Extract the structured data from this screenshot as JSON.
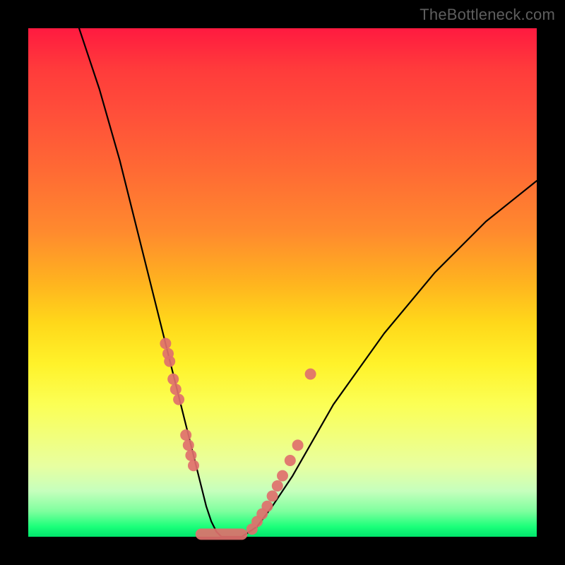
{
  "watermark": "TheBottleneck.com",
  "chart_data": {
    "type": "line",
    "title": "",
    "xlabel": "",
    "ylabel": "",
    "xlim": [
      0,
      100
    ],
    "ylim": [
      0,
      100
    ],
    "curve": {
      "x": [
        10,
        12,
        14,
        16,
        18,
        20,
        22,
        24,
        26,
        27,
        28,
        29,
        30,
        31,
        32,
        33,
        34,
        35,
        36,
        37,
        38,
        40,
        42,
        45,
        48,
        52,
        56,
        60,
        65,
        70,
        75,
        80,
        85,
        90,
        95,
        100
      ],
      "y": [
        100,
        94,
        88,
        81,
        74,
        66,
        58,
        50,
        42,
        38,
        34,
        30,
        26,
        22,
        18,
        14,
        10,
        6,
        3,
        1,
        0,
        0,
        0,
        2,
        6,
        12,
        19,
        26,
        33,
        40,
        46,
        52,
        57,
        62,
        66,
        70
      ]
    },
    "markers_left": {
      "x": [
        27.0,
        27.5,
        27.8,
        28.5,
        29.0,
        29.6,
        31.0,
        31.5,
        32.0,
        32.5
      ],
      "y": [
        38.0,
        36.0,
        34.5,
        31.0,
        29.0,
        27.0,
        20.0,
        18.0,
        16.0,
        14.0
      ]
    },
    "markers_right": {
      "x": [
        44.0,
        45.0,
        46.0,
        47.0,
        48.0,
        49.0,
        50.0,
        51.5,
        53.0
      ],
      "y": [
        1.5,
        3.0,
        4.5,
        6.0,
        8.0,
        10.0,
        12.0,
        15.0,
        18.0
      ]
    },
    "markers_right_outlier": {
      "x": 55.5,
      "y": 32.0
    },
    "valley_blob": {
      "x_start": 34.0,
      "x_end": 42.0,
      "y": 0.5
    },
    "gradient_stops": [
      {
        "pct": 0,
        "color": "#ff1a40"
      },
      {
        "pct": 40,
        "color": "#ff8a2e"
      },
      {
        "pct": 66,
        "color": "#fff22a"
      },
      {
        "pct": 100,
        "color": "#00e56b"
      }
    ]
  }
}
